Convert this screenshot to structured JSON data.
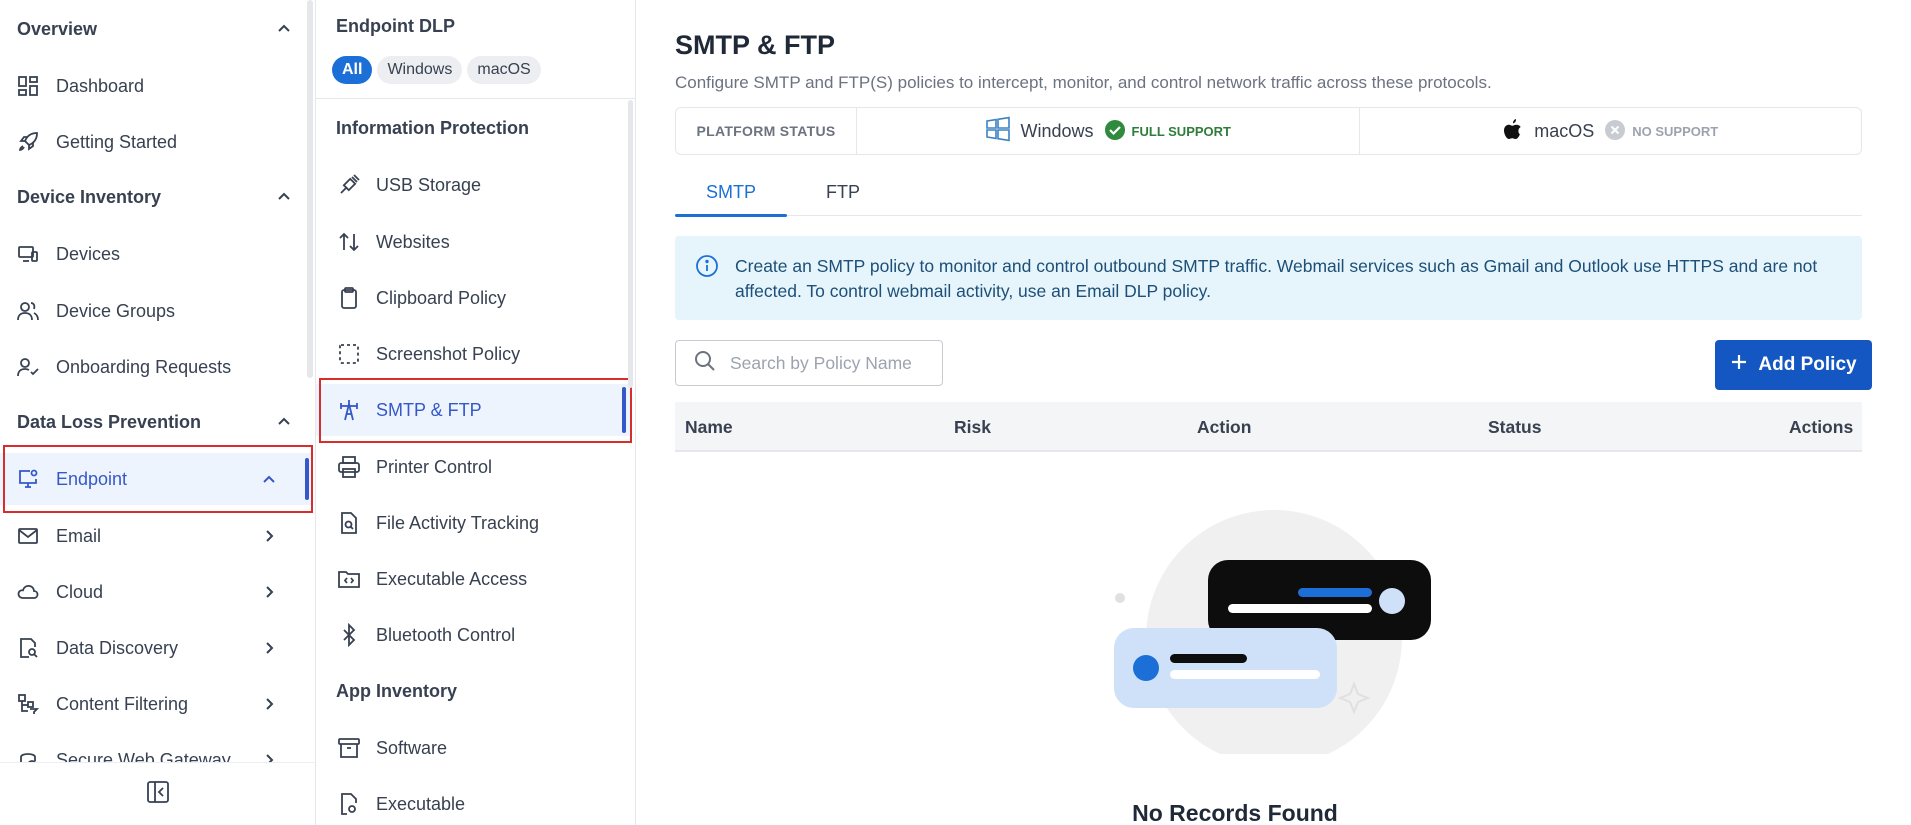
{
  "sidebar": {
    "sections": [
      {
        "title": "Overview"
      },
      {
        "title": "Device Inventory"
      },
      {
        "title": "Data Loss Prevention"
      }
    ],
    "items": [
      {
        "label": "Dashboard",
        "icon": "dashboard-icon"
      },
      {
        "label": "Getting Started",
        "icon": "rocket-icon"
      },
      {
        "label": "Devices",
        "icon": "devices-icon"
      },
      {
        "label": "Device Groups",
        "icon": "users-icon"
      },
      {
        "label": "Onboarding Requests",
        "icon": "user-check-icon"
      },
      {
        "label": "Endpoint",
        "icon": "monitor-gear-icon",
        "active": true
      },
      {
        "label": "Email",
        "icon": "mail-icon"
      },
      {
        "label": "Cloud",
        "icon": "cloud-icon"
      },
      {
        "label": "Data Discovery",
        "icon": "file-search-icon"
      },
      {
        "label": "Content Filtering",
        "icon": "filter-tree-icon"
      },
      {
        "label": "Secure Web Gateway",
        "icon": "gateway-icon"
      }
    ]
  },
  "subnav": {
    "title": "Endpoint DLP",
    "chips": [
      {
        "label": "All",
        "active": true
      },
      {
        "label": "Windows"
      },
      {
        "label": "macOS"
      }
    ],
    "groups": [
      {
        "title": "Information Protection"
      },
      {
        "title": "App Inventory"
      }
    ],
    "items": [
      {
        "label": "USB Storage",
        "icon": "usb-icon"
      },
      {
        "label": "Websites",
        "icon": "arrows-updown-icon"
      },
      {
        "label": "Clipboard Policy",
        "icon": "clipboard-icon"
      },
      {
        "label": "Screenshot Policy",
        "icon": "screenshot-icon"
      },
      {
        "label": "SMTP & FTP",
        "icon": "tower-icon",
        "active": true
      },
      {
        "label": "Printer Control",
        "icon": "printer-icon"
      },
      {
        "label": "File Activity Tracking",
        "icon": "file-search-icon"
      },
      {
        "label": "Executable Access",
        "icon": "folder-code-icon"
      },
      {
        "label": "Bluetooth Control",
        "icon": "bluetooth-icon"
      },
      {
        "label": "Software",
        "icon": "archive-icon"
      },
      {
        "label": "Executable",
        "icon": "file-gear-icon"
      }
    ]
  },
  "main": {
    "title": "SMTP & FTP",
    "description": "Configure SMTP and FTP(S) policies to intercept, monitor, and control network traffic across these protocols.",
    "platform": {
      "label": "PLATFORM STATUS",
      "windows": {
        "name": "Windows",
        "status": "FULL SUPPORT"
      },
      "macos": {
        "name": "macOS",
        "status": "NO SUPPORT"
      }
    },
    "tabs": [
      {
        "label": "SMTP",
        "active": true
      },
      {
        "label": "FTP"
      }
    ],
    "info": "Create an SMTP policy to monitor and control outbound SMTP traffic. Webmail services such as Gmail and Outlook use HTTPS and are not affected. To control webmail activity, use an Email DLP policy.",
    "search": {
      "placeholder": "Search by Policy Name",
      "value": ""
    },
    "add_button": "Add Policy",
    "table": {
      "columns": [
        "Name",
        "Risk",
        "Action",
        "Status",
        "Actions"
      ]
    },
    "empty_text": "No Records Found"
  },
  "colors": {
    "accent": "#1d6fd8",
    "active_nav": "#3558c9",
    "button": "#1557c2",
    "info_bg": "#e6f5fb",
    "full_support": "#2f7d3c",
    "highlight": "#d72d2d"
  }
}
